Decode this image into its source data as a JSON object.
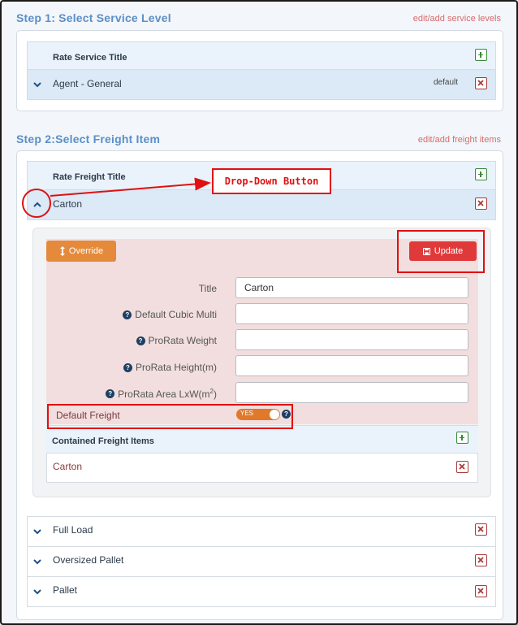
{
  "step1": {
    "title": "Step 1: Select Service Level",
    "link": "edit/add service levels",
    "table_header": "Rate Service Title",
    "rows": [
      {
        "label": "Agent - General",
        "tag": "default"
      }
    ]
  },
  "step2": {
    "title": "Step 2:Select Freight Item",
    "link": "edit/add freight items",
    "table_header": "Rate Freight Title",
    "selected_row": "Carton",
    "other_rows": [
      "Full Load",
      "Oversized Pallet",
      "Pallet"
    ]
  },
  "annotation": {
    "label": "Drop-Down Button"
  },
  "editor": {
    "override_label": "Override",
    "update_label": "Update",
    "fields": [
      {
        "label": "Title",
        "value": "Carton",
        "help": false
      },
      {
        "label": "Default Cubic Multi",
        "value": "",
        "help": true
      },
      {
        "label": "ProRata Weight",
        "value": "",
        "help": true
      },
      {
        "label": "ProRata Height(m)",
        "value": "",
        "help": true
      },
      {
        "label": "ProRata Area LxW(m",
        "sup": "2",
        "close": ")",
        "value": "",
        "help": true
      }
    ],
    "default_freight_label": "Default Freight",
    "toggle_label": "YES",
    "toggle_on": true,
    "contained_header": "Contained Freight Items",
    "contained_items": [
      "Carton"
    ]
  },
  "colors": {
    "step_title": "#5b8fc7",
    "link": "#d86b6b",
    "annotation_red": "#e01010",
    "override_orange": "#e58a3a",
    "update_red": "#e0393a",
    "toggle_orange": "#e07a2a"
  },
  "icons": [
    "chevron-down-icon",
    "chevron-up-icon",
    "add-icon",
    "delete-icon",
    "help-icon",
    "save-icon",
    "updown-arrow-icon"
  ]
}
